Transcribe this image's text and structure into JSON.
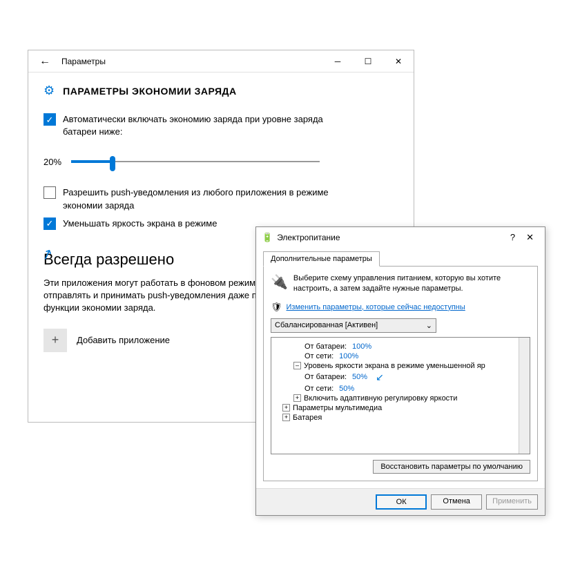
{
  "settings": {
    "title": "Параметры",
    "heading": "ПАРАМЕТРЫ ЭКОНОМИИ ЗАРЯДА",
    "check_auto": "Автоматически включать экономию заряда при уровне заряда батареи ниже:",
    "slider_value": "20%",
    "check_push": "Разрешить push-уведомления из любого приложения в режиме экономии заряда",
    "check_dim": "Уменьшать яркость экрана в режиме",
    "section_title": "Всегда разрешено",
    "section_desc": "Эти приложения могут работать в фоновом режиме, а также отправлять и принимать push-уведомления даже при включенной функции экономии заряда.",
    "add_app": "Добавить приложение"
  },
  "power": {
    "title": "Электропитание",
    "tab": "Дополнительные параметры",
    "desc": "Выберите схему управления питанием, которую вы хотите настроить, а затем задайте нужные параметры.",
    "link": "Изменить параметры, которые сейчас недоступны",
    "scheme": "Сбалансированная [Активен]",
    "tree": {
      "batt1_label": "От батареи:",
      "batt1_val": "100%",
      "net1_label": "От сети:",
      "net1_val": "100%",
      "dim_label": "Уровень яркости экрана в режиме уменьшенной яр",
      "batt2_label": "От батареи:",
      "batt2_val": "50%",
      "net2_label": "От сети:",
      "net2_val": "50%",
      "adaptive": "Включить адаптивную регулировку яркости",
      "multimedia": "Параметры мультимедиа",
      "battery": "Батарея"
    },
    "restore": "Восстановить параметры по умолчанию",
    "ok": "ОК",
    "cancel": "Отмена",
    "apply": "Применить"
  }
}
